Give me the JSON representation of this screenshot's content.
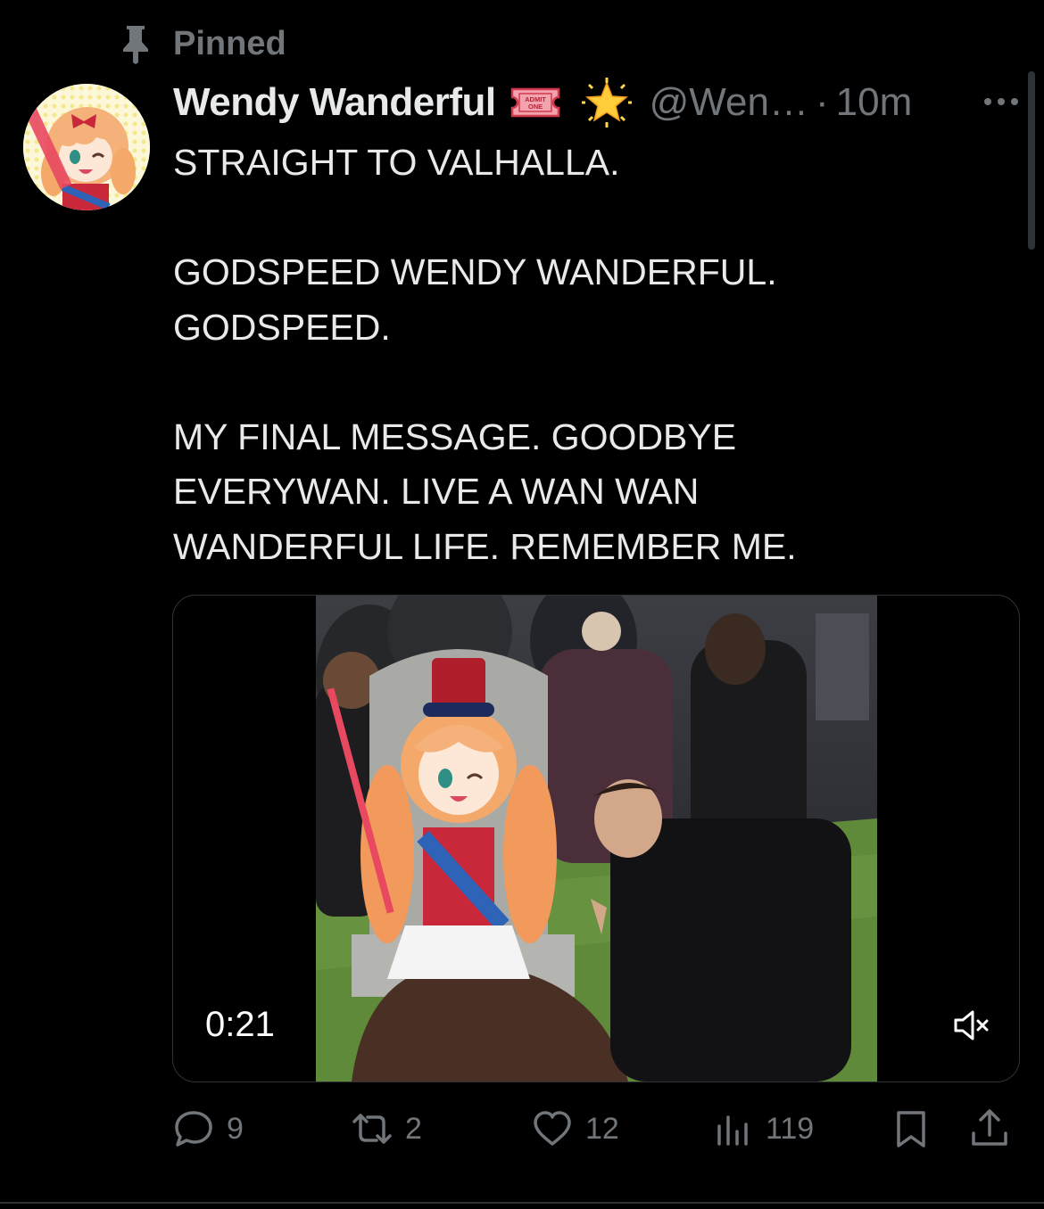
{
  "pinned": {
    "label": "Pinned"
  },
  "tweet": {
    "display_name": "Wendy Wanderful",
    "badges": [
      "ticket-icon",
      "sparkle-star-icon"
    ],
    "ticket_text": "ADMIT ONE",
    "handle": "@Wen…",
    "separator": "·",
    "time": "10m",
    "text": "STRAIGHT TO VALHALLA.\n\nGODSPEED WENDY WANDERFUL.\nGODSPEED.\n\nMY FINAL MESSAGE. GOODBYE\nEVERYWAN. LIVE A WAN WAN\nWANDERFUL LIFE. REMEMBER ME.",
    "video": {
      "duration": "0:21",
      "muted": true
    }
  },
  "actions": {
    "replies": "9",
    "reposts": "2",
    "likes": "12",
    "views": "119"
  },
  "colors": {
    "background": "#000000",
    "text": "#e7e9ea",
    "muted": "#71767b",
    "border": "#2f3336"
  }
}
